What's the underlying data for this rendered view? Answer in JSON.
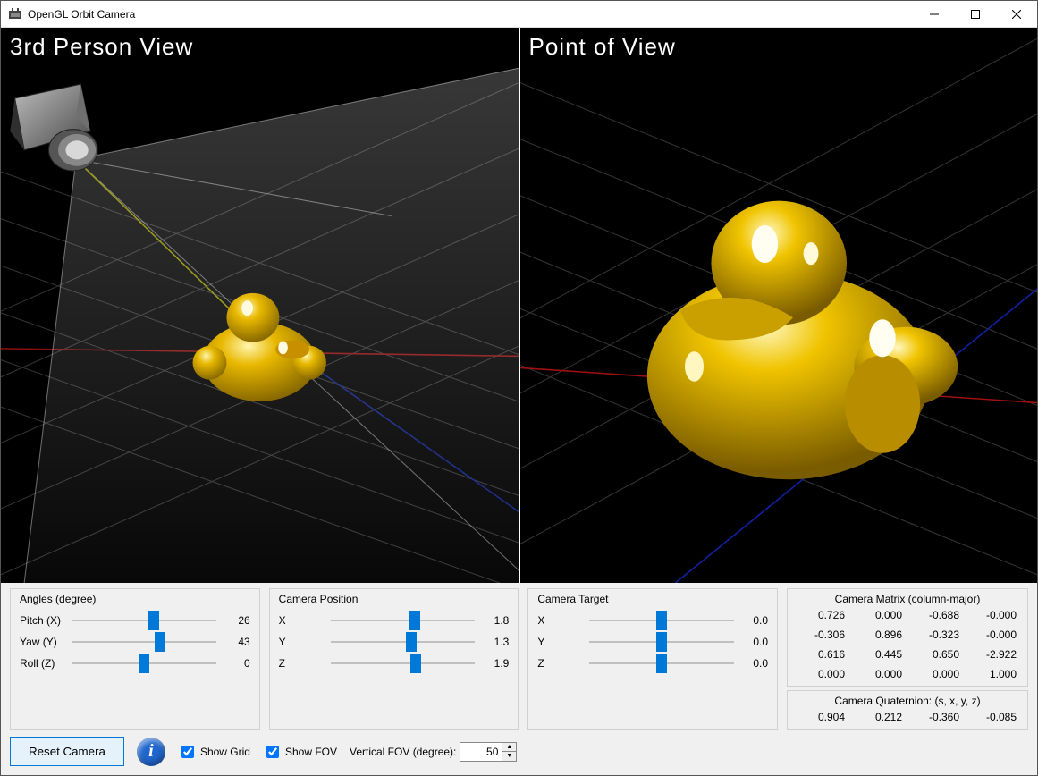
{
  "window": {
    "title": "OpenGL Orbit Camera"
  },
  "viewports": {
    "left_title": "3rd Person View",
    "right_title": "Point of View"
  },
  "angles": {
    "group_label": "Angles (degree)",
    "pitch": {
      "label": "Pitch (X)",
      "value": 26,
      "min": -180,
      "max": 180
    },
    "yaw": {
      "label": "Yaw (Y)",
      "value": 43,
      "min": -180,
      "max": 180
    },
    "roll": {
      "label": "Roll (Z)",
      "value": 0,
      "min": -180,
      "max": 180
    }
  },
  "camera_position": {
    "group_label": "Camera Position",
    "x": {
      "label": "X",
      "value": 1.8,
      "min": -10,
      "max": 10
    },
    "y": {
      "label": "Y",
      "value": 1.3,
      "min": -10,
      "max": 10
    },
    "z": {
      "label": "Z",
      "value": 1.9,
      "min": -10,
      "max": 10
    }
  },
  "camera_target": {
    "group_label": "Camera Target",
    "x": {
      "label": "X",
      "value": 0.0,
      "min": -10,
      "max": 10
    },
    "y": {
      "label": "Y",
      "value": 0.0,
      "min": -10,
      "max": 10
    },
    "z": {
      "label": "Z",
      "value": 0.0,
      "min": -10,
      "max": 10
    }
  },
  "camera_matrix": {
    "label": "Camera Matrix (column-major)",
    "rows": [
      [
        "0.726",
        "0.000",
        "-0.688",
        "-0.000"
      ],
      [
        "-0.306",
        "0.896",
        "-0.323",
        "-0.000"
      ],
      [
        "0.616",
        "0.445",
        "0.650",
        "-2.922"
      ],
      [
        "0.000",
        "0.000",
        "0.000",
        "1.000"
      ]
    ]
  },
  "camera_quaternion": {
    "label": "Camera Quaternion: (s, x, y, z)",
    "values": [
      "0.904",
      "0.212",
      "-0.360",
      "-0.085"
    ]
  },
  "footer": {
    "reset_label": "Reset Camera",
    "show_grid_label": "Show Grid",
    "show_grid_checked": true,
    "show_fov_label": "Show FOV",
    "show_fov_checked": true,
    "fov_label": "Vertical FOV (degree):",
    "fov_value": 50
  },
  "colors": {
    "duck": "#d9a900",
    "duck_hi": "#ffe060",
    "axis_x": "#a01010",
    "axis_z": "#1020a0",
    "axis_up": "#808000",
    "grid": "#333333"
  }
}
